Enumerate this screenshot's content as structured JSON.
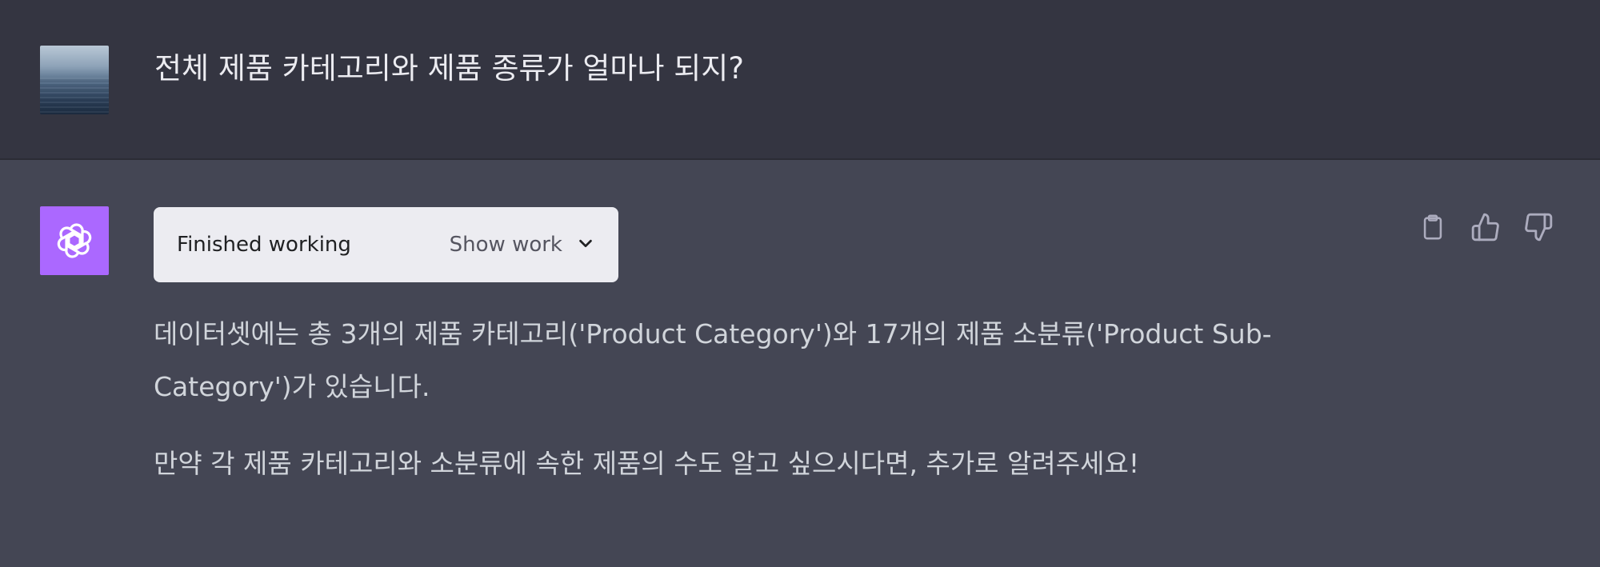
{
  "user_message": {
    "text": "전체 제품 카테고리와 제품 종류가 얼마나 되지?",
    "avatar": "ocean-photo-avatar"
  },
  "assistant_message": {
    "logo": "openai-logo-icon",
    "logo_color": "#ab68ff",
    "work_status": "Finished working",
    "show_work_label": "Show work",
    "paragraphs": [
      "데이터셋에는 총 3개의 제품 카테고리('Product Category')와 17개의 제품 소분류('Product Sub-Category')가 있습니다.",
      "만약 각 제품 카테고리와 소분류에 속한 제품의 수도 알고 싶으시다면, 추가로 알려주세요!"
    ]
  },
  "actions": {
    "copy": "clipboard-icon",
    "like": "thumbs-up-icon",
    "dislike": "thumbs-down-icon"
  },
  "colors": {
    "user_bg": "#343541",
    "assistant_bg": "#444654",
    "text": "#d1d5db"
  }
}
